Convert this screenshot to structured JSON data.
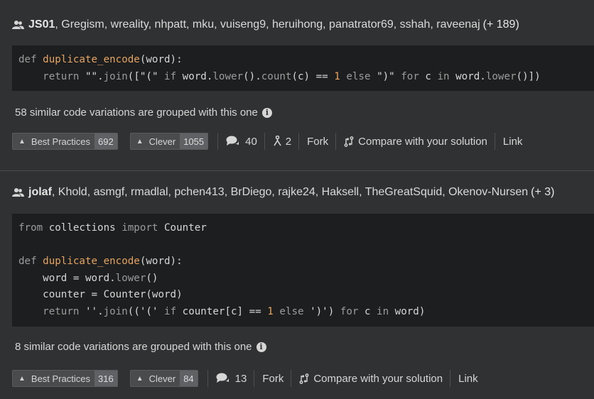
{
  "solutions": [
    {
      "lead_author": "JS01",
      "other_authors": ", Gregism, wreality, nhpatt, mku, vuiseng9, heruihong, panatrator69, sshah, raveenaj",
      "more_count": "(+ 189)",
      "variations_text": "58 similar code variations are grouped with this one",
      "best_practices_label": "Best Practices",
      "best_practices_count": "692",
      "clever_label": "Clever",
      "clever_count": "1055",
      "comments_count": "40",
      "forks_count": "2",
      "fork_label": "Fork",
      "compare_label": "Compare with your solution",
      "link_label": "Link"
    },
    {
      "lead_author": "jolaf",
      "other_authors": ", Khold, asmgf, rmadlal, pchen413, BrDiego, rajke24, Haksell, TheGreatSquid, Okenov-Nursen",
      "more_count": "(+ 3)",
      "variations_text": "8 similar code variations are grouped with this one",
      "best_practices_label": "Best Practices",
      "best_practices_count": "316",
      "clever_label": "Clever",
      "clever_count": "84",
      "comments_count": "13",
      "fork_label": "Fork",
      "compare_label": "Compare with your solution",
      "link_label": "Link"
    }
  ],
  "icons": {
    "users": "users-icon",
    "info": "info-icon",
    "caret": "caret-up-icon",
    "comments": "comments-icon",
    "fork": "fork-icon",
    "compare": "compare-icon"
  },
  "colors": {
    "background": "#303133",
    "code_background": "#1d1e20",
    "function_name": "#e5a461"
  }
}
